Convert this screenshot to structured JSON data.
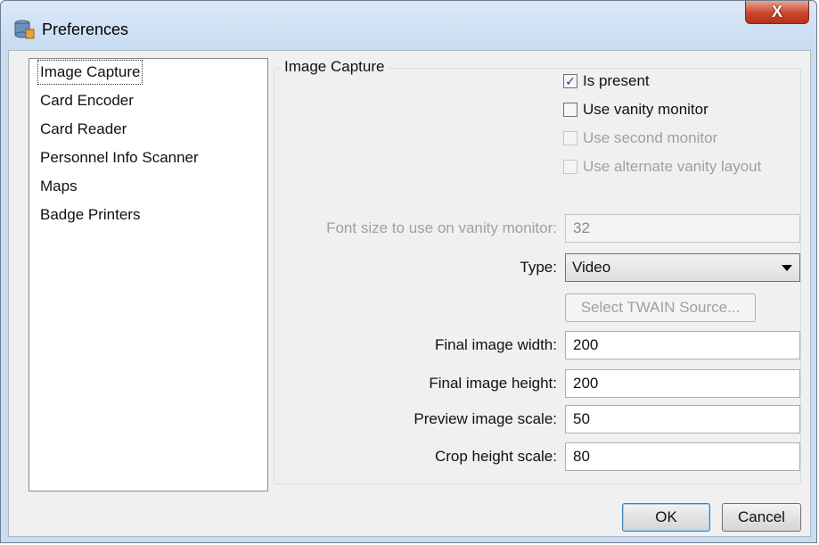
{
  "window": {
    "title": "Preferences",
    "close_glyph": "X"
  },
  "nav": {
    "items": [
      {
        "label": "Image Capture",
        "selected": true
      },
      {
        "label": "Card Encoder"
      },
      {
        "label": "Card Reader"
      },
      {
        "label": "Personnel Info Scanner"
      },
      {
        "label": "Maps"
      },
      {
        "label": "Badge Printers"
      }
    ]
  },
  "panel": {
    "title": "Image Capture",
    "checkboxes": [
      {
        "label": "Is present",
        "checked": true,
        "enabled": true
      },
      {
        "label": "Use vanity monitor",
        "checked": false,
        "enabled": true
      },
      {
        "label": "Use second monitor",
        "checked": false,
        "enabled": false
      },
      {
        "label": "Use alternate vanity layout",
        "checked": false,
        "enabled": false
      }
    ],
    "font_size": {
      "label": "Font size to use on vanity monitor:",
      "value": "32"
    },
    "type": {
      "label": "Type:",
      "value": "Video"
    },
    "twain_button": "Select TWAIN Source...",
    "final_width": {
      "label": "Final image width:",
      "value": "200"
    },
    "final_height": {
      "label": "Final image height:",
      "value": "200"
    },
    "preview_scale": {
      "label": "Preview image scale:",
      "value": "50"
    },
    "crop_scale": {
      "label": "Crop height scale:",
      "value": "80"
    }
  },
  "buttons": {
    "ok": "OK",
    "cancel": "Cancel"
  },
  "colors": {
    "close": "#c9462c",
    "check": "#1a3f8e"
  }
}
